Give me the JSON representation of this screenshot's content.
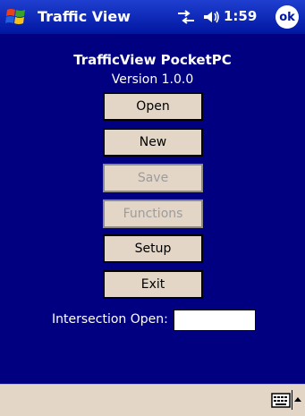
{
  "titlebar": {
    "title": "Traffic View",
    "clock": "1:59",
    "ok_label": "ok",
    "icons": [
      "windows-start-icon",
      "connectivity-icon",
      "speaker-icon"
    ]
  },
  "main": {
    "app_title": "TrafficView PocketPC",
    "version": "Version 1.0.0",
    "buttons": [
      {
        "label": "Open",
        "enabled": true
      },
      {
        "label": "New",
        "enabled": true
      },
      {
        "label": "Save",
        "enabled": false
      },
      {
        "label": "Functions",
        "enabled": false
      },
      {
        "label": "Setup",
        "enabled": true
      },
      {
        "label": "Exit",
        "enabled": true
      }
    ],
    "intersection_label": "Intersection Open:",
    "intersection_value": ""
  },
  "menubar": {
    "icons": [
      "keyboard-icon",
      "sip-arrow-icon"
    ]
  },
  "colors": {
    "background": "#000080",
    "titlebar": "#0016a0",
    "button_face": "#e3d6c6",
    "disabled_text": "#9c9c9c"
  }
}
